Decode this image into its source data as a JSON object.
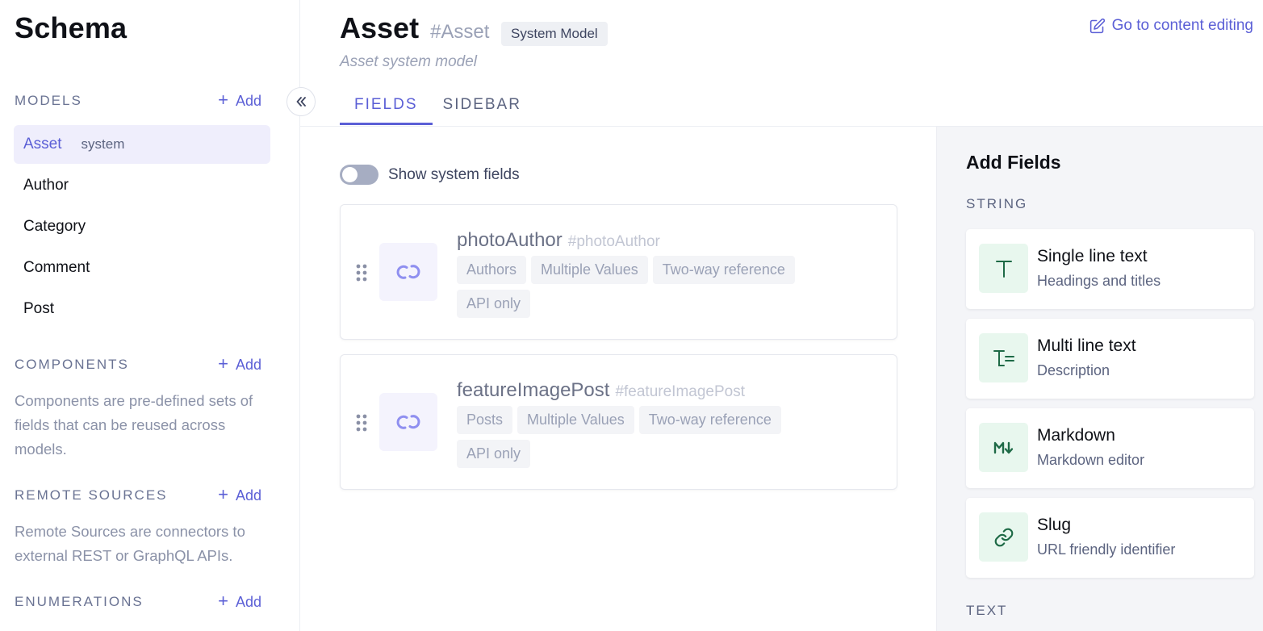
{
  "sidebar": {
    "title": "Schema",
    "models": {
      "label": "MODELS",
      "add_label": "Add",
      "items": [
        {
          "label": "Asset",
          "tag": "system"
        },
        {
          "label": "Author"
        },
        {
          "label": "Category"
        },
        {
          "label": "Comment"
        },
        {
          "label": "Post"
        }
      ]
    },
    "components": {
      "label": "COMPONENTS",
      "add_label": "Add",
      "description": "Components are pre-defined sets of fields that can be reused across models."
    },
    "remote_sources": {
      "label": "REMOTE SOURCES",
      "add_label": "Add",
      "description": "Remote Sources are connectors to external REST or GraphQL APIs."
    },
    "enumerations": {
      "label": "ENUMERATIONS",
      "add_label": "Add"
    }
  },
  "header": {
    "title": "Asset",
    "api_id": "#Asset",
    "badge": "System Model",
    "subtitle": "Asset system model",
    "goto_label": "Go to content editing"
  },
  "tabs": [
    {
      "label": "FIELDS",
      "active": true
    },
    {
      "label": "SIDEBAR",
      "active": false
    }
  ],
  "fields_view": {
    "toggle_label": "Show system fields",
    "toggle_on": false,
    "fields": [
      {
        "name": "photoAuthor",
        "api_id": "#photoAuthor",
        "icon": "reference-link-icon",
        "chips": [
          "Authors",
          "Multiple Values",
          "Two-way reference",
          "API only"
        ]
      },
      {
        "name": "featureImagePost",
        "api_id": "#featureImagePost",
        "icon": "reference-link-icon",
        "chips": [
          "Posts",
          "Multiple Values",
          "Two-way reference",
          "API only"
        ]
      }
    ]
  },
  "add_fields": {
    "title": "Add Fields",
    "sections": [
      {
        "label": "STRING",
        "items": [
          {
            "title": "Single line text",
            "description": "Headings and titles",
            "icon": "text-t-icon"
          },
          {
            "title": "Multi line text",
            "description": "Description",
            "icon": "multiline-text-icon"
          },
          {
            "title": "Markdown",
            "description": "Markdown editor",
            "icon": "markdown-icon"
          },
          {
            "title": "Slug",
            "description": "URL friendly identifier",
            "icon": "slug-link-icon"
          }
        ]
      },
      {
        "label": "TEXT",
        "items": []
      }
    ]
  },
  "colors": {
    "accent": "#5b5fd6",
    "active_bg": "#efeefc",
    "field_icon_bg": "#f4f3fd",
    "type_icon_bg": "#e8f7ee",
    "type_icon_fg": "#1e6a46"
  }
}
